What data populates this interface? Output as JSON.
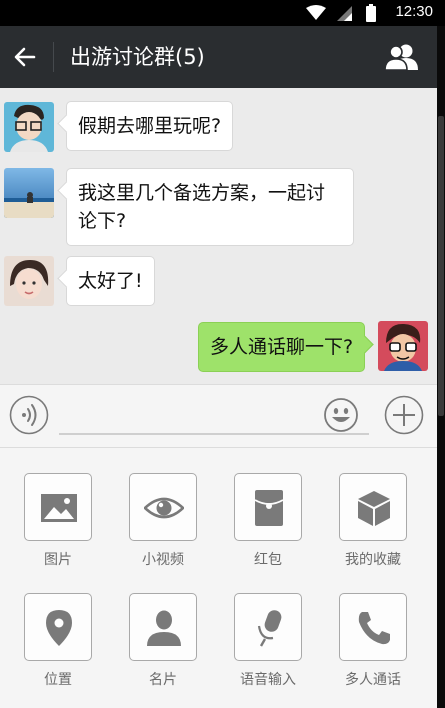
{
  "status_bar": {
    "time": "12:30"
  },
  "header": {
    "title": "出游讨论群(5)"
  },
  "messages": [
    {
      "side": "left",
      "text": "假期去哪里玩呢?"
    },
    {
      "side": "left",
      "text_line1": "我这里几个备选方案，一起讨",
      "text_line2": "论下?"
    },
    {
      "side": "left",
      "text": "太好了!"
    },
    {
      "side": "right",
      "text": "多人通话聊一下?"
    }
  ],
  "panel": {
    "items": [
      {
        "label": "图片",
        "icon": "image-icon"
      },
      {
        "label": "小视频",
        "icon": "eye-icon"
      },
      {
        "label": "红包",
        "icon": "red-packet-icon"
      },
      {
        "label": "我的收藏",
        "icon": "cube-icon"
      },
      {
        "label": "位置",
        "icon": "location-pin-icon"
      },
      {
        "label": "名片",
        "icon": "person-card-icon"
      },
      {
        "label": "语音输入",
        "icon": "microphone-icon"
      },
      {
        "label": "多人通话",
        "icon": "phone-icon"
      }
    ]
  },
  "colors": {
    "header": "#2a2d30",
    "chat_bg": "#ebebeb",
    "my_bubble": "#9ee26a",
    "panel_bg": "#f5f5f5"
  }
}
